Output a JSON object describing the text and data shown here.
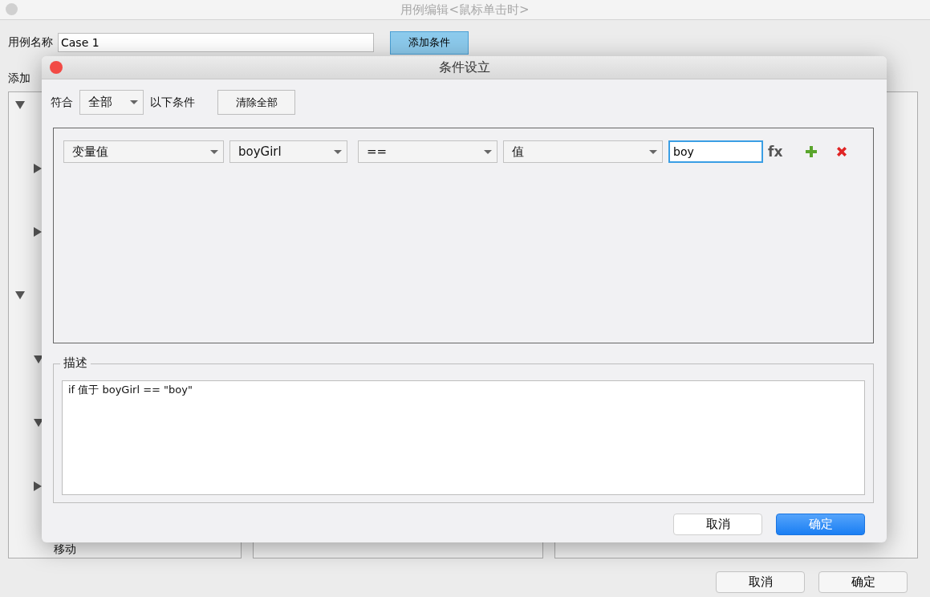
{
  "window": {
    "title": "用例编辑<鼠标单击时>"
  },
  "case_name": {
    "label": "用例名称",
    "value": "Case 1"
  },
  "add_condition_button": "添加条件",
  "actions_label": "添加",
  "action_tree": [
    {
      "expanded": true
    },
    {
      "expanded": false
    },
    {
      "expanded": false
    },
    {
      "expanded": true
    },
    {
      "expanded": true
    },
    {
      "expanded": true
    },
    {
      "expanded": false
    },
    {
      "label": "移动"
    }
  ],
  "buttons": [
    "取消",
    "确定"
  ],
  "dialog": {
    "title": "条件设立",
    "match_label": "符合",
    "match_mode": "全部",
    "match_suffix": "以下条件",
    "clear_button": "清除全部",
    "conditions": [
      {
        "type": "变量值",
        "variable": "boyGirl",
        "operator": "==",
        "value_type": "值",
        "value": "boy",
        "focused": true,
        "fx": "fx"
      }
    ],
    "description": {
      "legend": "描述",
      "text": "if 值于 boyGirl == \"boy\""
    },
    "buttons": [
      {
        "label": "取消",
        "default": false
      },
      {
        "label": "确定",
        "default": true
      }
    ]
  }
}
